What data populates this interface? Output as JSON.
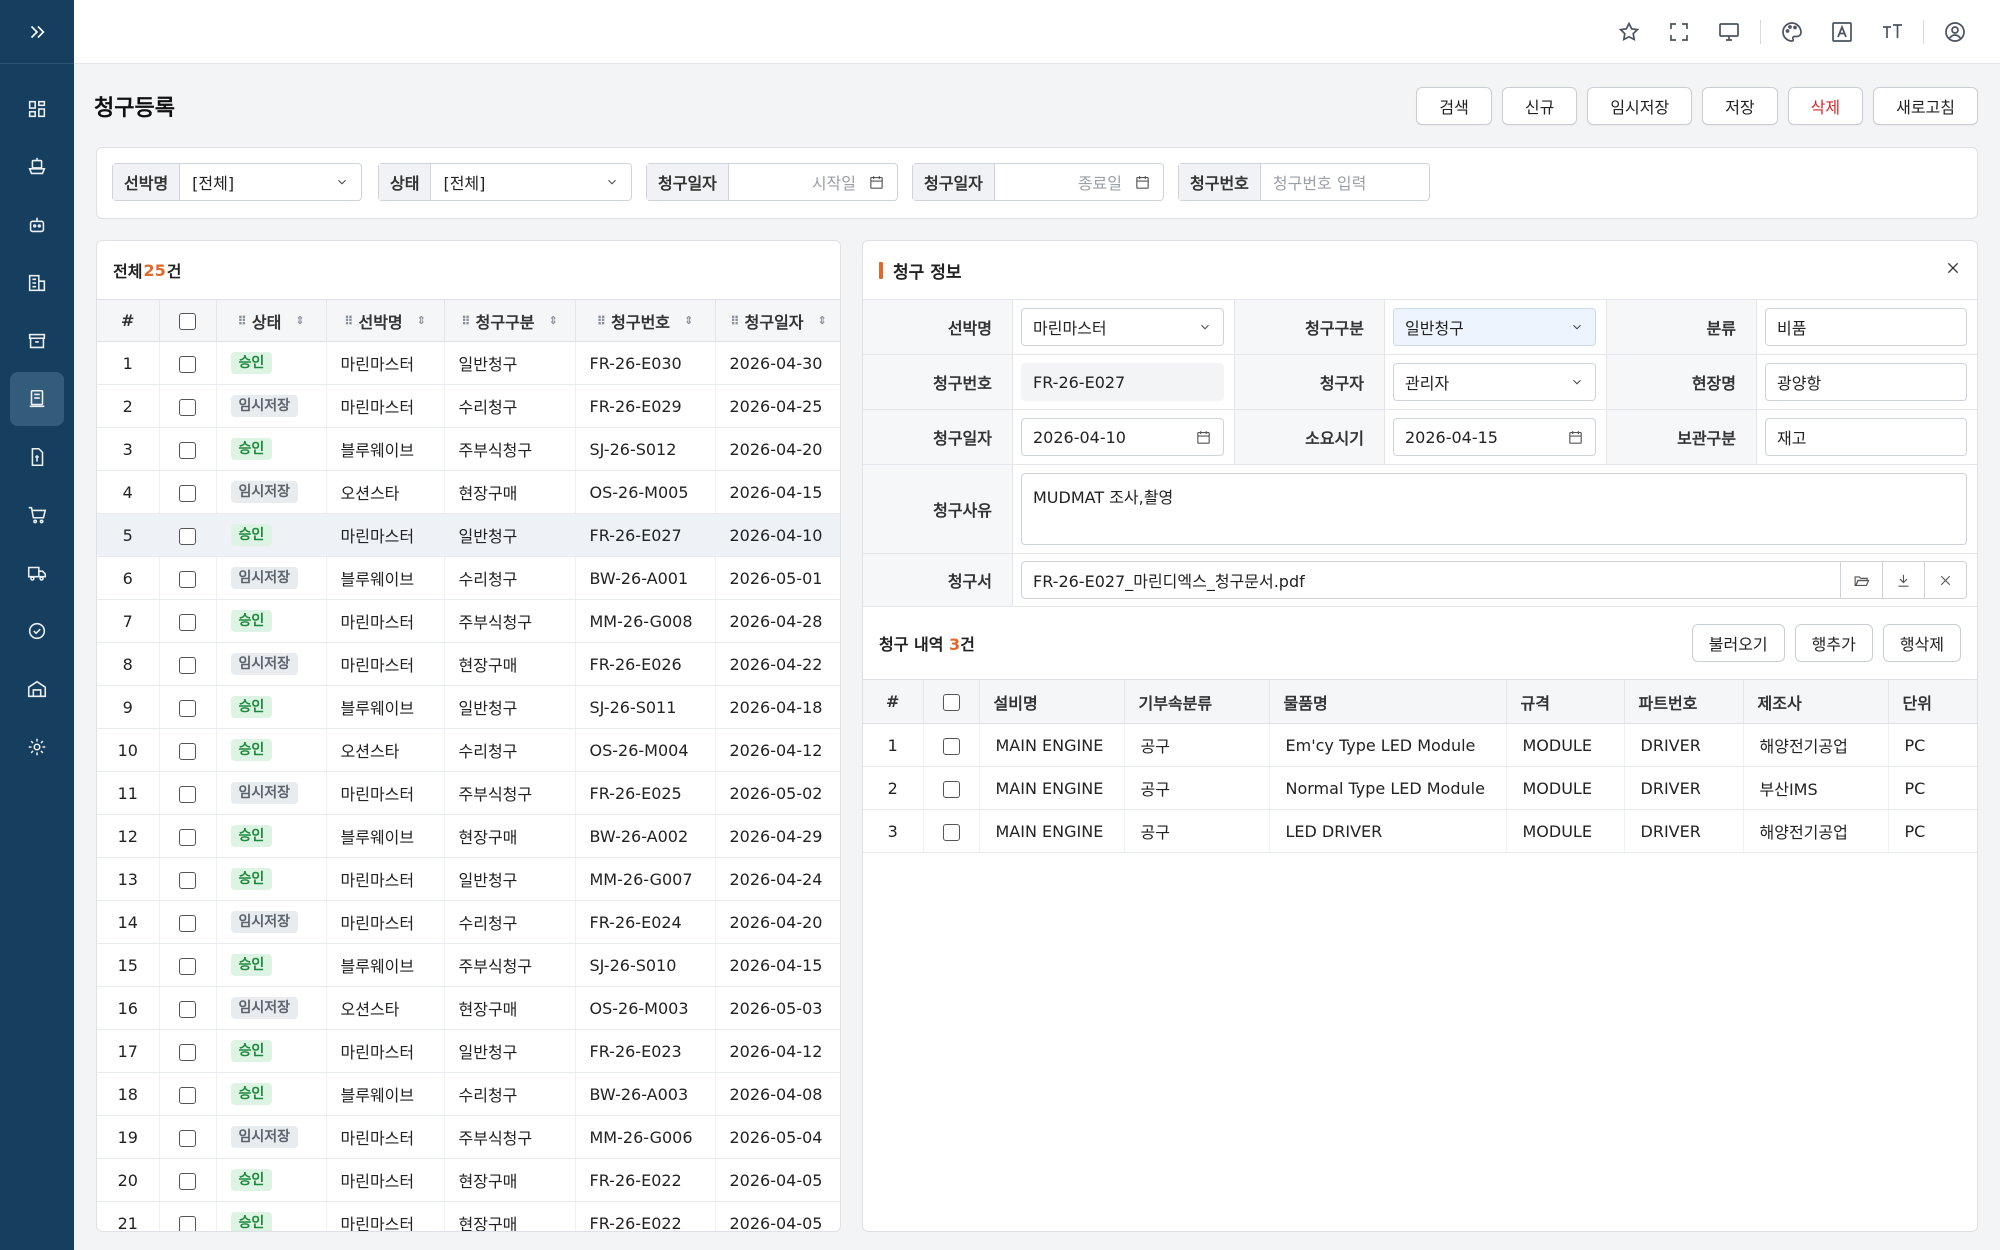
{
  "page_title": "청구등록",
  "actions": {
    "search": "검색",
    "new": "신규",
    "temp_save": "임시저장",
    "save": "저장",
    "delete": "삭제",
    "refresh": "새로고침"
  },
  "filters": {
    "vessel": {
      "label": "선박명",
      "value": "[전체]"
    },
    "status": {
      "label": "상태",
      "value": "[전체]"
    },
    "date_from": {
      "label": "청구일자",
      "placeholder": "시작일"
    },
    "date_to": {
      "label": "청구일자",
      "placeholder": "종료일"
    },
    "req_no": {
      "label": "청구번호",
      "placeholder": "청구번호 입력"
    }
  },
  "list": {
    "total_prefix": "전체 ",
    "total_count": "25",
    "total_suffix": "건",
    "columns": {
      "no": "#",
      "status": "상태",
      "vessel": "선박명",
      "type": "청구구분",
      "req_no": "청구번호",
      "date": "청구일자"
    },
    "rows": [
      {
        "no": "1",
        "status": "승인",
        "status_kind": "approved",
        "vessel": "마린마스터",
        "type": "일반청구",
        "req_no": "FR-26-E030",
        "date": "2026-04-30"
      },
      {
        "no": "2",
        "status": "임시저장",
        "status_kind": "temp",
        "vessel": "마린마스터",
        "type": "수리청구",
        "req_no": "FR-26-E029",
        "date": "2026-04-25"
      },
      {
        "no": "3",
        "status": "승인",
        "status_kind": "approved",
        "vessel": "블루웨이브",
        "type": "주부식청구",
        "req_no": "SJ-26-S012",
        "date": "2026-04-20"
      },
      {
        "no": "4",
        "status": "임시저장",
        "status_kind": "temp",
        "vessel": "오션스타",
        "type": "현장구매",
        "req_no": "OS-26-M005",
        "date": "2026-04-15"
      },
      {
        "no": "5",
        "status": "승인",
        "status_kind": "approved",
        "vessel": "마린마스터",
        "type": "일반청구",
        "req_no": "FR-26-E027",
        "date": "2026-04-10",
        "selected": true
      },
      {
        "no": "6",
        "status": "임시저장",
        "status_kind": "temp",
        "vessel": "블루웨이브",
        "type": "수리청구",
        "req_no": "BW-26-A001",
        "date": "2026-05-01"
      },
      {
        "no": "7",
        "status": "승인",
        "status_kind": "approved",
        "vessel": "마린마스터",
        "type": "주부식청구",
        "req_no": "MM-26-G008",
        "date": "2026-04-28"
      },
      {
        "no": "8",
        "status": "임시저장",
        "status_kind": "temp",
        "vessel": "마린마스터",
        "type": "현장구매",
        "req_no": "FR-26-E026",
        "date": "2026-04-22"
      },
      {
        "no": "9",
        "status": "승인",
        "status_kind": "approved",
        "vessel": "블루웨이브",
        "type": "일반청구",
        "req_no": "SJ-26-S011",
        "date": "2026-04-18"
      },
      {
        "no": "10",
        "status": "승인",
        "status_kind": "approved",
        "vessel": "오션스타",
        "type": "수리청구",
        "req_no": "OS-26-M004",
        "date": "2026-04-12"
      },
      {
        "no": "11",
        "status": "임시저장",
        "status_kind": "temp",
        "vessel": "마린마스터",
        "type": "주부식청구",
        "req_no": "FR-26-E025",
        "date": "2026-05-02"
      },
      {
        "no": "12",
        "status": "승인",
        "status_kind": "approved",
        "vessel": "블루웨이브",
        "type": "현장구매",
        "req_no": "BW-26-A002",
        "date": "2026-04-29"
      },
      {
        "no": "13",
        "status": "승인",
        "status_kind": "approved",
        "vessel": "마린마스터",
        "type": "일반청구",
        "req_no": "MM-26-G007",
        "date": "2026-04-24"
      },
      {
        "no": "14",
        "status": "임시저장",
        "status_kind": "temp",
        "vessel": "마린마스터",
        "type": "수리청구",
        "req_no": "FR-26-E024",
        "date": "2026-04-20"
      },
      {
        "no": "15",
        "status": "승인",
        "status_kind": "approved",
        "vessel": "블루웨이브",
        "type": "주부식청구",
        "req_no": "SJ-26-S010",
        "date": "2026-04-15"
      },
      {
        "no": "16",
        "status": "임시저장",
        "status_kind": "temp",
        "vessel": "오션스타",
        "type": "현장구매",
        "req_no": "OS-26-M003",
        "date": "2026-05-03"
      },
      {
        "no": "17",
        "status": "승인",
        "status_kind": "approved",
        "vessel": "마린마스터",
        "type": "일반청구",
        "req_no": "FR-26-E023",
        "date": "2026-04-12"
      },
      {
        "no": "18",
        "status": "승인",
        "status_kind": "approved",
        "vessel": "블루웨이브",
        "type": "수리청구",
        "req_no": "BW-26-A003",
        "date": "2026-04-08"
      },
      {
        "no": "19",
        "status": "임시저장",
        "status_kind": "temp",
        "vessel": "마린마스터",
        "type": "주부식청구",
        "req_no": "MM-26-G006",
        "date": "2026-05-04"
      },
      {
        "no": "20",
        "status": "승인",
        "status_kind": "approved",
        "vessel": "마린마스터",
        "type": "현장구매",
        "req_no": "FR-26-E022",
        "date": "2026-04-05"
      },
      {
        "no": "21",
        "status": "승인",
        "status_kind": "approved",
        "vessel": "마린마스터",
        "type": "현장구매",
        "req_no": "FR-26-E022",
        "date": "2026-04-05"
      }
    ]
  },
  "detail": {
    "title": "청구 정보",
    "vessel": {
      "label": "선박명",
      "value": "마린마스터"
    },
    "req_type": {
      "label": "청구구분",
      "value": "일반청구"
    },
    "category": {
      "label": "분류",
      "value": "비품"
    },
    "req_no": {
      "label": "청구번호",
      "value": "FR-26-E027"
    },
    "requester": {
      "label": "청구자",
      "value": "관리자"
    },
    "site": {
      "label": "현장명",
      "value": "광양항"
    },
    "req_date": {
      "label": "청구일자",
      "value": "2026-04-10"
    },
    "due_date": {
      "label": "소요시기",
      "value": "2026-04-15"
    },
    "storage": {
      "label": "보관구분",
      "value": "재고"
    },
    "reason": {
      "label": "청구사유",
      "value": "MUDMAT 조사,촬영"
    },
    "doc": {
      "label": "청구서",
      "value": "FR-26-E027_마린디엑스_청구문서.pdf"
    }
  },
  "items": {
    "title_prefix": "청구 내역 ",
    "count": "3",
    "title_suffix": "건",
    "load_label": "불러오기",
    "add_row_label": "행추가",
    "del_row_label": "행삭제",
    "columns": {
      "no": "#",
      "equip": "설비명",
      "sub": "기부속분류",
      "item": "물품명",
      "spec": "규격",
      "part": "파트번호",
      "maker": "제조사",
      "unit": "단위"
    },
    "rows": [
      {
        "no": "1",
        "equip": "MAIN ENGINE",
        "sub": "공구",
        "item": "Em'cy Type LED Module",
        "spec": "MODULE",
        "part": "DRIVER",
        "maker": "해양전기공업",
        "unit": "PC"
      },
      {
        "no": "2",
        "equip": "MAIN ENGINE",
        "sub": "공구",
        "item": "Normal Type LED Module",
        "spec": "MODULE",
        "part": "DRIVER",
        "maker": "부산IMS",
        "unit": "PC"
      },
      {
        "no": "3",
        "equip": "MAIN ENGINE",
        "sub": "공구",
        "item": "LED DRIVER",
        "spec": "MODULE",
        "part": "DRIVER",
        "maker": "해양전기공업",
        "unit": "PC"
      }
    ]
  },
  "colors": {
    "sidebar": "#163f5f",
    "accent": "#e06a2c",
    "danger": "#d8262b",
    "approved_bg": "#ddf3e3",
    "approved_text": "#1d8a3c"
  },
  "sidebar_icons": [
    "expand-icon",
    "dashboard-icon",
    "ship-icon",
    "robot-icon",
    "building-icon",
    "archive-icon",
    "request-icon",
    "document-icon",
    "cart-icon",
    "truck-icon",
    "check-circle-icon",
    "warehouse-icon",
    "settings-icon"
  ],
  "topbar_icons": [
    "star-icon",
    "fullscreen-icon",
    "monitor-icon",
    "palette-icon",
    "font-icon",
    "text-size-icon",
    "user-icon"
  ]
}
